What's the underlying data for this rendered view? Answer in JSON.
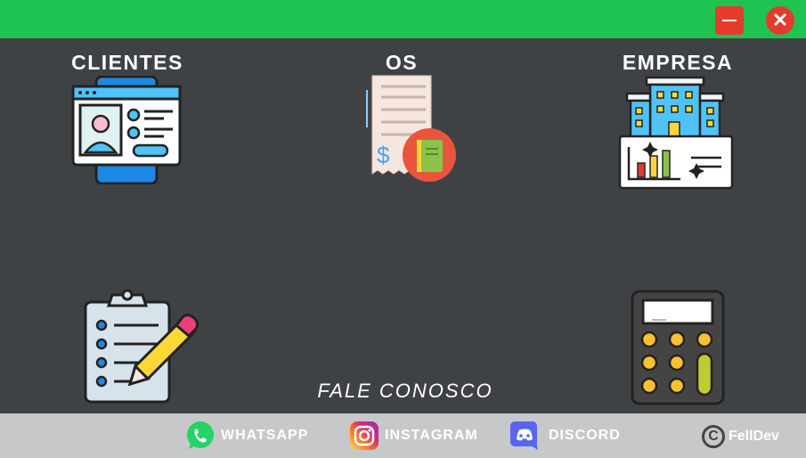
{
  "window": {
    "minimize_icon": "minimize-icon",
    "close_icon": "close-icon",
    "close_glyph": "✕",
    "accent_color": "#1fc352",
    "window_button_color": "#e43b2c"
  },
  "tiles": {
    "clientes": {
      "label": "CLIENTES",
      "icon": "id-card-icon"
    },
    "os": {
      "label": "OS",
      "icon": "receipt-icon"
    },
    "empresa": {
      "label": "EMPRESA",
      "icon": "company-building-icon"
    },
    "orders": {
      "icon": "clipboard-pencil-icon"
    },
    "calculator": {
      "icon": "calculator-icon"
    }
  },
  "contact_title": "FALE CONOSCO",
  "footer": {
    "whatsapp": {
      "label": "WHATSAPP",
      "icon": "whatsapp-icon",
      "color": "#25d366"
    },
    "instagram": {
      "label": "INSTAGRAM",
      "icon": "instagram-icon"
    },
    "discord": {
      "label": "DISCORD",
      "icon": "discord-icon",
      "color": "#5865f2"
    },
    "brand": {
      "label": "FellDev",
      "copyright_glyph": "C"
    }
  },
  "colors": {
    "background": "#3f4244",
    "footer": "#c7c8c9"
  }
}
